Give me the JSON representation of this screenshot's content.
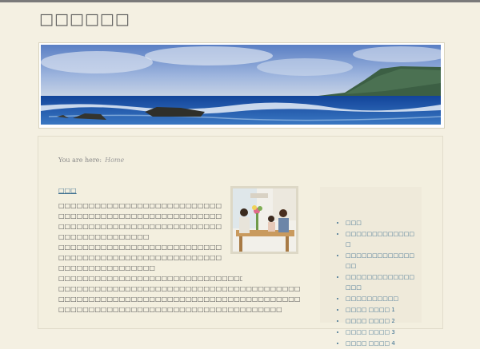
{
  "site": {
    "title": "□□□□□□"
  },
  "breadcrumb": {
    "prefix": "You are here:",
    "home": "Home"
  },
  "entry": {
    "title": "□□□",
    "paragraphs": [
      "□□□□□□□□□□□□□□□□□□□□□□□□□□□□□□□□□□□□□□□□□□□□□□□□□□□□□□□□□□□□□□□□□□□□□□□□□□□□□□□□□□□□□□□□□□□□□□□□",
      "□□□□□□□□□□□□□□□□□□□□□□□□□□□□□□□□□□□□□□□□□□□□□□□□□□□□□□□□□□□□□□□□□□□□□□",
      "□□□□□□□□□□□□□□□□□□□□□□□□□□□□□□□",
      "□□□□□□□□□□□□□□□□□□□□□□□□□□□□□□□□□□□□□□□□□□□□□□□□□□□□□□□□□□□□□□□□□□□□□□□□□□□□□□□□□□□□□□□□□□□□□□□□□□□□□□□□□□□□□□□□□□□□□"
    ]
  },
  "sidebar": {
    "items": [
      "□□□",
      "□□□□□□□□□□□□□□",
      "□□□□□□□□□□□□□□□",
      "□□□□□□□□□□□□□□□□",
      "□□□□□□□□□□",
      "□□□□ □□□□ 1",
      "□□□□ □□□□ 2",
      "□□□□ □□□□ 3",
      "□□□□ □□□□ 4"
    ]
  },
  "colors": {
    "background": "#f4f0e2",
    "link": "#3b6e8f",
    "text": "#555555",
    "sea": "#1f57a8",
    "sky": "#6f93cf"
  }
}
